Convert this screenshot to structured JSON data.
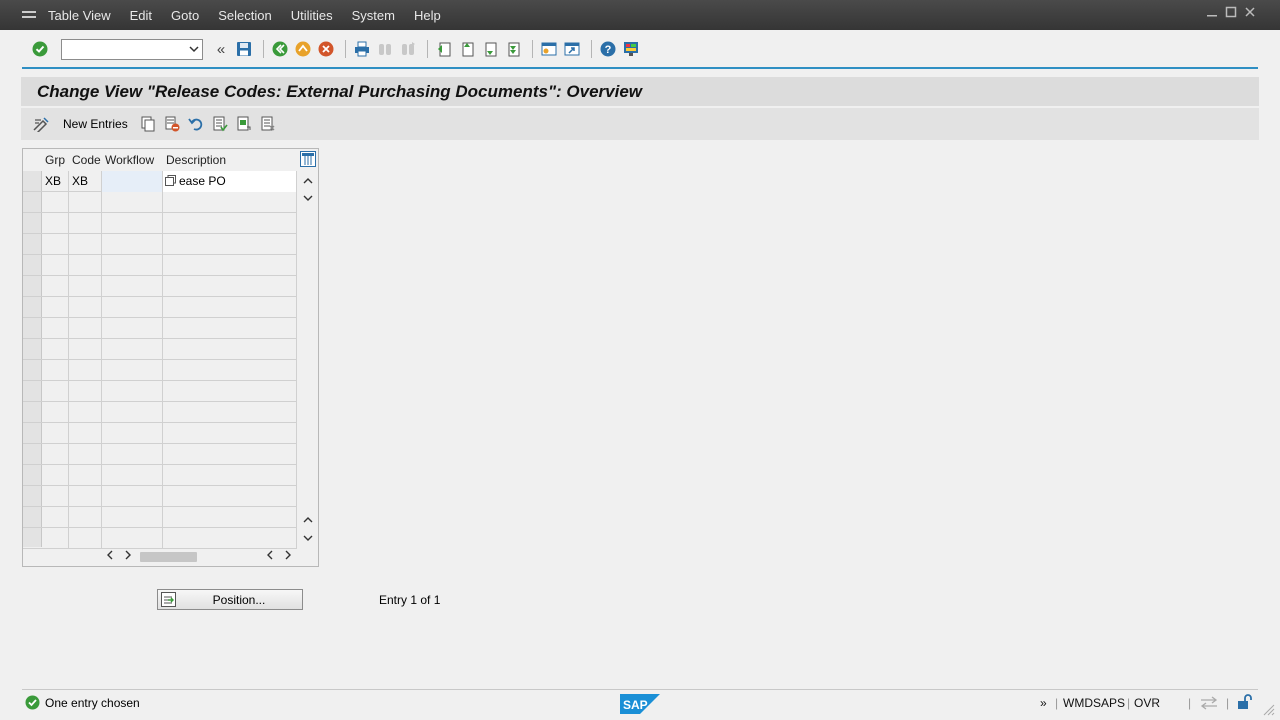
{
  "menu": {
    "items": [
      {
        "id": "table-view",
        "label": "Table View"
      },
      {
        "id": "edit",
        "label": "Edit"
      },
      {
        "id": "goto",
        "label": "Goto"
      },
      {
        "id": "selection",
        "label": "Selection"
      },
      {
        "id": "utilities",
        "label": "Utilities"
      },
      {
        "id": "system",
        "label": "System"
      },
      {
        "id": "help",
        "label": "Help"
      }
    ]
  },
  "toolbar": {
    "command_field_value": ""
  },
  "page": {
    "title": "Change View \"Release Codes: External Purchasing Documents\": Overview"
  },
  "app_toolbar": {
    "new_entries_label": "New Entries"
  },
  "table": {
    "columns": [
      "Grp",
      "Code",
      "Workflow",
      "Description"
    ],
    "rows": [
      {
        "grp": "XB",
        "code": "XB",
        "workflow": "",
        "description": "ease PO"
      }
    ]
  },
  "position_button": {
    "label": "Position..."
  },
  "entry_info": "Entry 1 of 1",
  "status": {
    "message": "One entry chosen",
    "more": "»",
    "system": "WMDSAPS",
    "mode": "OVR"
  },
  "colors": {
    "accent": "#2f8fc3",
    "success": "#3a9a3a",
    "sap_blue": "#1a8fd6"
  }
}
